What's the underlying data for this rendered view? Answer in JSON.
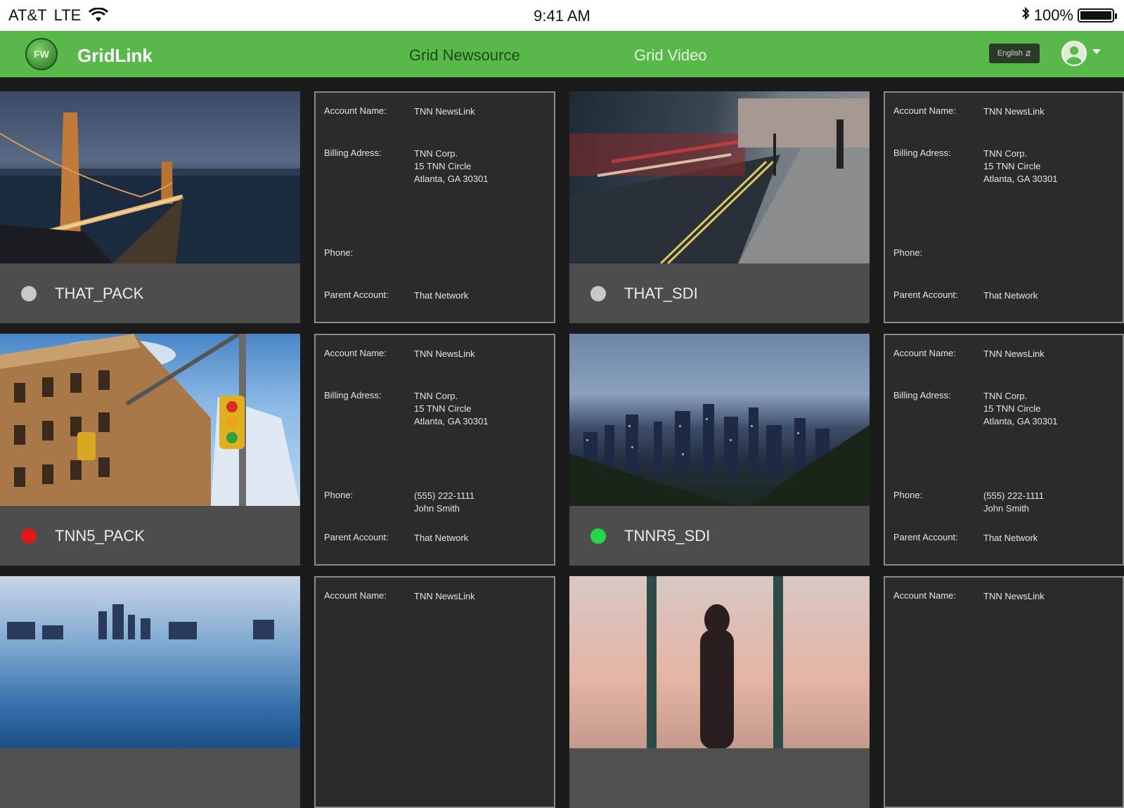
{
  "status_bar": {
    "carrier": "AT&T",
    "network": "LTE",
    "time": "9:41 AM",
    "battery": "100%",
    "battery_level": 1.0
  },
  "nav": {
    "logo_text": "FW",
    "app_name": "GridLink",
    "links": [
      "Grid Newsource",
      "Grid Video"
    ],
    "language": "English",
    "accent_color": "#58b84a"
  },
  "labels": {
    "account_name": "Account Name:",
    "billing_address": "Billing Adress:",
    "phone": "Phone:",
    "parent_account": "Parent Account:"
  },
  "tiles": [
    {
      "name": "THAT_PACK",
      "status": "offline",
      "status_color": "#c8c8c8",
      "account_name": "TNN NewsLink",
      "billing_address": [
        "TNN Corp.",
        "15 TNN Circle",
        "Atlanta, GA 30301"
      ],
      "phone": [],
      "parent_account": "That Network"
    },
    {
      "name": "THAT_SDI",
      "status": "offline",
      "status_color": "#c8c8c8",
      "account_name": "TNN NewsLink",
      "billing_address": [
        "TNN Corp.",
        "15 TNN Circle",
        "Atlanta, GA 30301"
      ],
      "phone": [],
      "parent_account": "That Network"
    },
    {
      "name": "TNN5_PACK",
      "status": "error",
      "status_color": "#e01818",
      "account_name": "TNN NewsLink",
      "billing_address": [
        "TNN Corp.",
        "15 TNN Circle",
        "Atlanta, GA 30301"
      ],
      "phone": [
        "(555) 222-1111",
        "John Smith"
      ],
      "parent_account": "That Network"
    },
    {
      "name": "TNNR5_SDI",
      "status": "online",
      "status_color": "#22d84a",
      "account_name": "TNN NewsLink",
      "billing_address": [
        "TNN Corp.",
        "15 TNN Circle",
        "Atlanta, GA 30301"
      ],
      "phone": [
        "(555) 222-1111",
        "John Smith"
      ],
      "parent_account": "That Network"
    },
    {
      "account_name": "TNN NewsLink"
    },
    {
      "account_name": "TNN NewsLink"
    }
  ]
}
